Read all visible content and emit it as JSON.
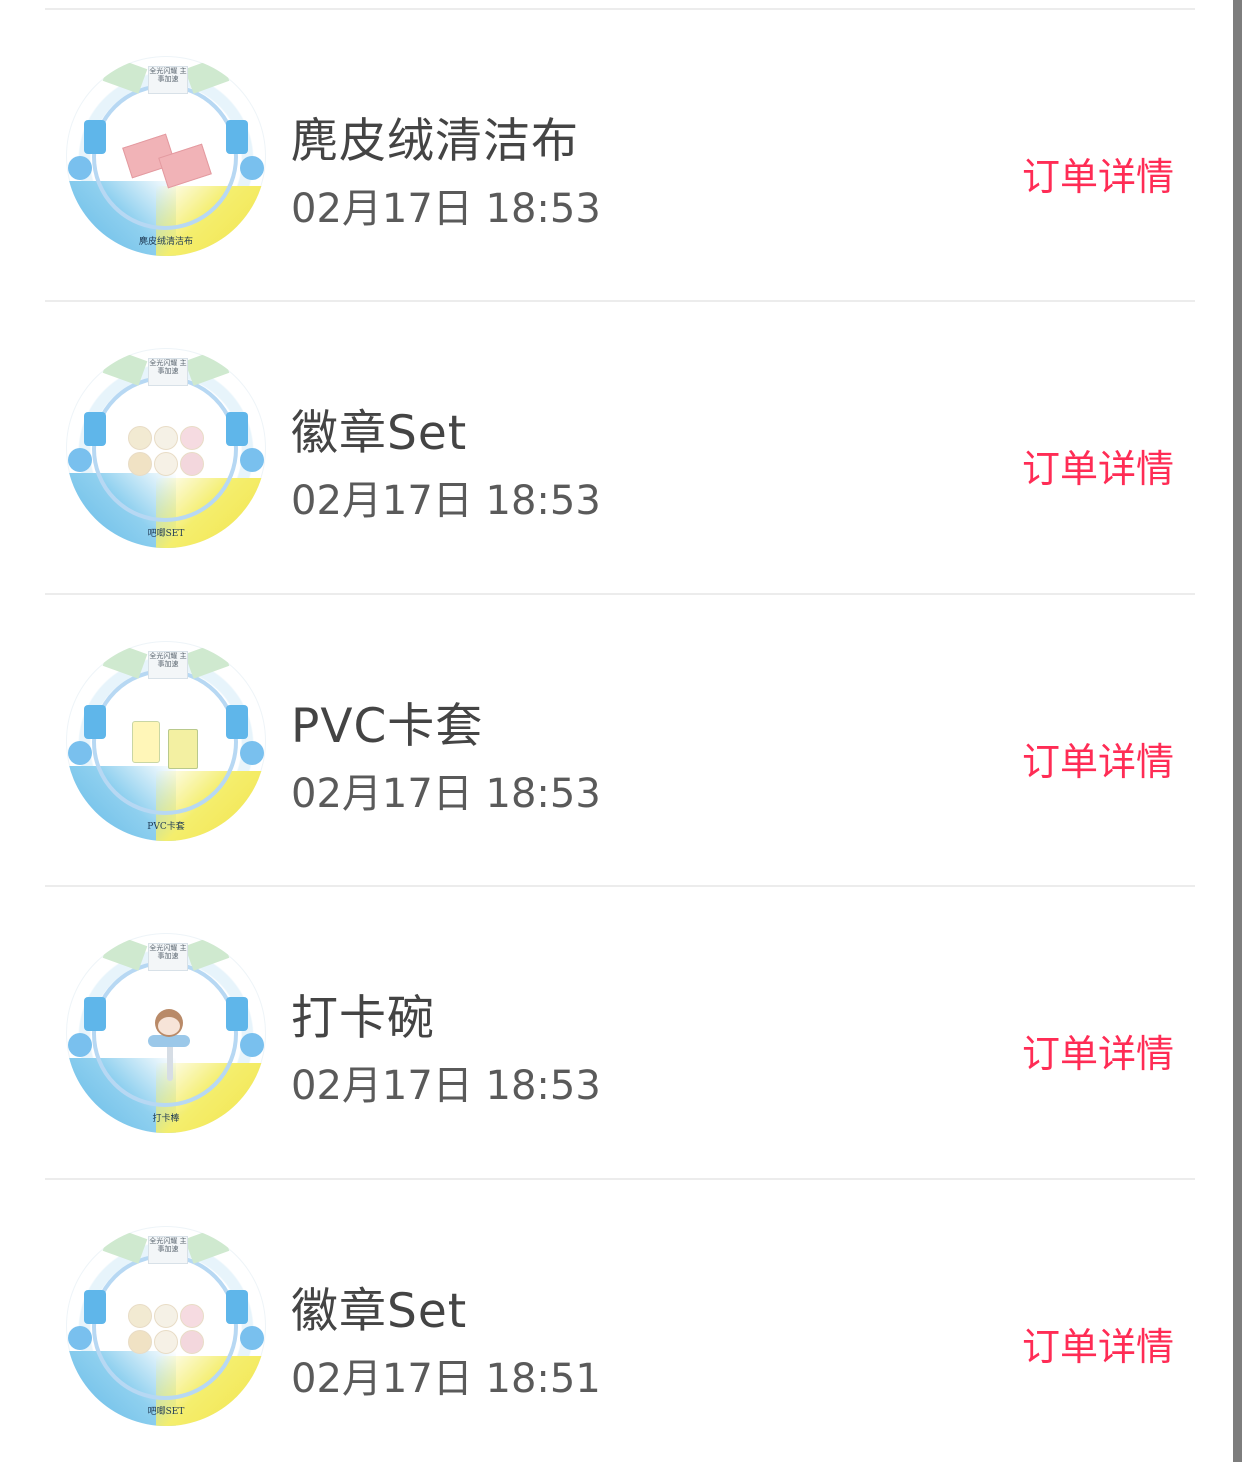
{
  "colors": {
    "accent": "#ff2c55",
    "title": "#444444",
    "time": "#5a5a5a",
    "divider": "#ececec",
    "scrollbar": "#7d7d7d"
  },
  "orders": [
    {
      "title": "麂皮绒清洁布",
      "time": "02月17日 18:53",
      "action": "订单详情",
      "thumb_caption": "麂皮绒清洁布",
      "thumb_logo": "全光闪耀 主事加速",
      "product_icon": "cleaning-cloth-icon"
    },
    {
      "title": "徽章Set",
      "time": "02月17日 18:53",
      "action": "订单详情",
      "thumb_caption": "吧唧SET",
      "thumb_logo": "全光闪耀 主事加速",
      "product_icon": "badge-set-icon"
    },
    {
      "title": "PVC卡套",
      "time": "02月17日 18:53",
      "action": "订单详情",
      "thumb_caption": "PVC卡套",
      "thumb_logo": "全光闪耀 主事加速",
      "product_icon": "card-sleeve-icon"
    },
    {
      "title": "打卡碗",
      "time": "02月17日 18:53",
      "action": "订单详情",
      "thumb_caption": "打卡棒",
      "thumb_logo": "全光闪耀 主事加速",
      "product_icon": "stick-icon"
    },
    {
      "title": "徽章Set",
      "time": "02月17日 18:51",
      "action": "订单详情",
      "thumb_caption": "吧唧SET",
      "thumb_logo": "全光闪耀 主事加速",
      "product_icon": "badge-set-icon"
    }
  ]
}
